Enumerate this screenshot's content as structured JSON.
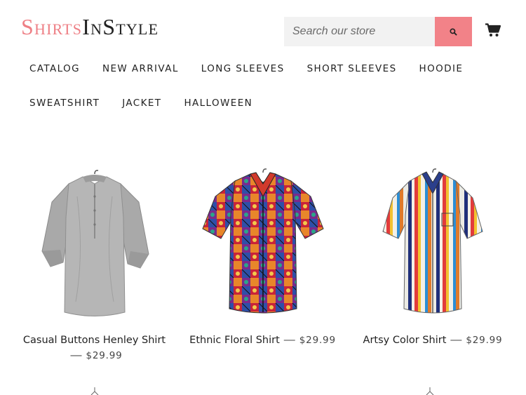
{
  "header": {
    "logo_segments": [
      {
        "text": "S",
        "size": "big",
        "color": "pink"
      },
      {
        "text": "HIRTS",
        "size": "small",
        "color": "pink"
      },
      {
        "text": "I",
        "size": "big",
        "color": "dark"
      },
      {
        "text": "N",
        "size": "small",
        "color": "dark"
      },
      {
        "text": "S",
        "size": "big",
        "color": "dark"
      },
      {
        "text": "TYLE",
        "size": "small",
        "color": "dark"
      }
    ],
    "search_placeholder": "Search our store",
    "search_icon": "search-icon",
    "cart_icon": "cart-icon"
  },
  "nav": {
    "row1": [
      "CATALOG",
      "NEW ARRIVAL",
      "LONG SLEEVES",
      "SHORT SLEEVES",
      "HOODIE"
    ],
    "row2": [
      "SWEATSHIRT",
      "JACKET",
      "HALLOWEEN"
    ]
  },
  "products": [
    {
      "title": "Casual Buttons Henley Shirt",
      "separator": "—",
      "price": "$29.99"
    },
    {
      "title": "Ethnic Floral Shirt",
      "separator": "—",
      "price": "$29.99"
    },
    {
      "title": "Artsy Color Shirt",
      "separator": "—",
      "price": "$29.99"
    }
  ],
  "colors": {
    "accent_pink": "#f28288",
    "logo_pink": "#ee7f85",
    "text_dark": "#222222",
    "search_bg": "#f2f2f2"
  }
}
